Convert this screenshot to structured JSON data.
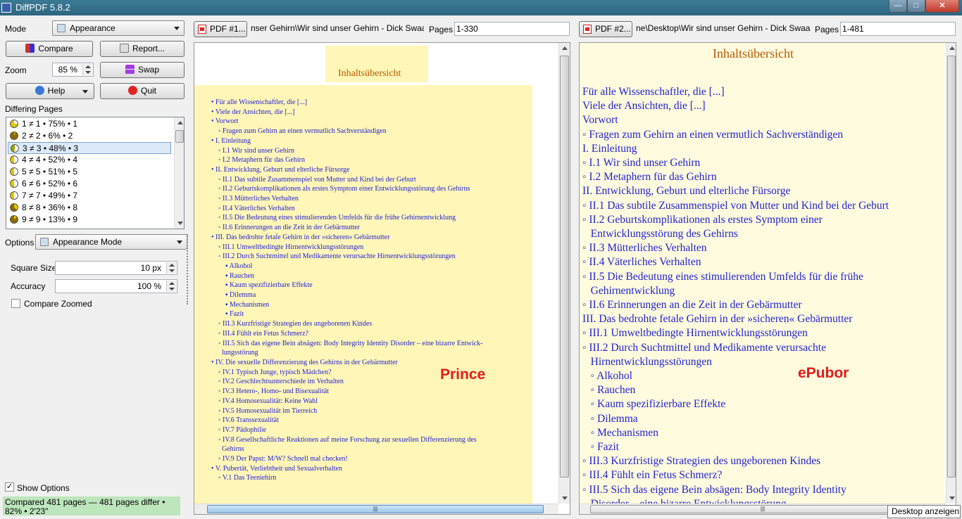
{
  "window": {
    "title": "DiffPDF 5.8.2",
    "min": "—",
    "max": "□",
    "close": "✕"
  },
  "left": {
    "mode_label": "Mode",
    "mode_value": "Appearance",
    "compare": "Compare",
    "report": "Report...",
    "zoom_label": "Zoom",
    "zoom_value": "85 %",
    "swap": "Swap",
    "help": "Help",
    "quit": "Quit",
    "differing_label": "Differing Pages",
    "pages": [
      "1 ≠ 1 • 75% • 1",
      "2 ≠ 2 • 6% • 2",
      "3 ≠ 3 • 48% • 3",
      "4 ≠ 4 • 52% • 4",
      "5 ≠ 5 • 51% • 5",
      "6 ≠ 6 • 52% • 6",
      "7 ≠ 7 • 49% • 7",
      "8 ≠ 8 • 36% • 8",
      "9 ≠ 9 • 13% • 9"
    ],
    "options_label": "Options",
    "options_value": "Appearance Mode",
    "square_label": "Square Size",
    "square_value": "10 px",
    "accuracy_label": "Accuracy",
    "accuracy_value": "100 %",
    "compare_zoomed": "Compare Zoomed",
    "show_options": "Show Options",
    "status": "Compared 481 pages — 481 pages differ • 82% • 2'23\""
  },
  "pdf1": {
    "button": "PDF #1...",
    "path": "nser Gehirn\\Wir sind unser Gehirn - Dick Swaab.pdf",
    "pages_label": "Pages",
    "pages_value": "1-330"
  },
  "pdf2": {
    "button": "PDF #2...",
    "path": "ne\\Desktop\\Wir sind unser Gehirn - Dick Swaab.pdf",
    "pages_label": "Pages",
    "pages_value": "1-481"
  },
  "toc_title": "Inhaltsübersicht",
  "left_view_label": "Prince",
  "right_view_label": "ePubor",
  "left_toc": [
    "• Für alle Wissenschaftler, die [...]",
    "• Viele der Ansichten, die [...]",
    "• Vorwort",
    "    ◦ Fragen zum Gehirn an einen vermutlich Sachverständigen",
    "• I. Einleitung",
    "    ◦ I.1 Wir sind unser Gehirn",
    "    ◦ I.2 Metaphern für das Gehirn",
    "• II. Entwicklung, Geburt und elterliche Fürsorge",
    "    ◦ II.1 Das subtile Zusammenspiel von Mutter und Kind bei der Geburt",
    "    ◦ II.2 Geburtskomplikationen als erstes Symptom einer Entwicklungsstörung des Gehirns",
    "    ◦ II.3 Mütterliches Verhalten",
    "    ◦ II.4 Väterliches Verhalten",
    "    ◦ II.5 Die Bedeutung eines stimulierenden Umfelds für die frühe Gehirnentwicklung",
    "    ◦ II.6 Erinnerungen an die Zeit in der Gebärmutter",
    "• III. Das bedrohte fetale Gehirn in der »sicheren« Gebärmutter",
    "    ◦ III.1 Umweltbedingte Hirnentwicklungsstörungen",
    "    ◦ III.2 Durch Suchtmittel und Medikamente verursachte Hirnentwicklungsstörungen",
    "        ▪ Alkohol",
    "        ▪ Rauchen",
    "        ▪ Kaum spezifizierbare Effekte",
    "        ▪ Dilemma",
    "        ▪ Mechanismen",
    "        ▪ Fazit",
    "    ◦ III.3 Kurzfristige Strategien des ungeborenen Kindes",
    "    ◦ III.4 Fühlt ein Fetus Schmerz?",
    "    ◦ III.5 Sich das eigene Bein absägen: Body Integrity Identity Disorder – eine bizarre Entwick-",
    "      lungsstörung",
    "• IV. Die sexuelle Differenzierung des Gehirns in der Gebärmutter",
    "    ◦ IV.1 Typisch Junge, typisch Mädchen?",
    "    ◦ IV.2 Geschlechtsunterschiede im Verhalten",
    "    ◦ IV.3 Hetero-, Homo- und Bisexualität",
    "    ◦ IV.4 Homosexualität: Keine Wahl",
    "    ◦ IV.5 Homosexualität im Tierreich",
    "    ◦ IV.6 Transsexualität",
    "    ◦ IV.7 Pädophilie",
    "    ◦ IV.8 Gesellschaftliche Reaktionen auf meine Forschung zur sexuellen Differenzierung des",
    "      Gehirns",
    "    ◦ IV.9 Der Papst: M/W? Schnell mal checken!",
    "• V. Pubertät, Verliebtheit und Sexualverhalten",
    "    ◦ V.1 Das Teeniehirn"
  ],
  "right_toc": [
    "Für alle Wissenschaftler, die [...]",
    "Viele der Ansichten, die [...]",
    "Vorwort",
    "◦ Fragen zum Gehirn an einen vermutlich Sachverständigen",
    "I. Einleitung",
    "◦ I.1 Wir sind unser Gehirn",
    "◦ I.2 Metaphern für das Gehirn",
    "II. Entwicklung, Geburt und elterliche Fürsorge",
    "◦ II.1 Das subtile Zusammenspiel von Mutter und Kind bei der Geburt",
    "◦ II.2 Geburtskomplikationen als erstes Symptom einer",
    "   Entwicklungsstörung des Gehirns",
    "◦ II.3 Mütterliches Verhalten",
    "◦ II.4 Väterliches Verhalten",
    "◦ II.5 Die Bedeutung eines stimulierenden Umfelds für die frühe",
    "   Gehirnentwicklung",
    "◦ II.6 Erinnerungen an die Zeit in der Gebärmutter",
    "III. Das bedrohte fetale Gehirn in der »sicheren« Gebärmutter",
    "◦ III.1 Umweltbedingte Hirnentwicklungsstörungen",
    "◦ III.2 Durch Suchtmittel und Medikamente verursachte",
    "   Hirnentwicklungsstörungen",
    "   ◦ Alkohol",
    "   ◦ Rauchen",
    "   ◦ Kaum spezifizierbare Effekte",
    "   ◦ Dilemma",
    "   ◦ Mechanismen",
    "   ◦ Fazit",
    "◦ III.3 Kurzfristige Strategien des ungeborenen Kindes",
    "◦ III.4 Fühlt ein Fetus Schmerz?",
    "◦ III.5 Sich das eigene Bein absägen: Body Integrity Identity",
    "   Disorder – eine bizarre Entwicklungsstörung"
  ],
  "tooltip": "Desktop anzeigen"
}
